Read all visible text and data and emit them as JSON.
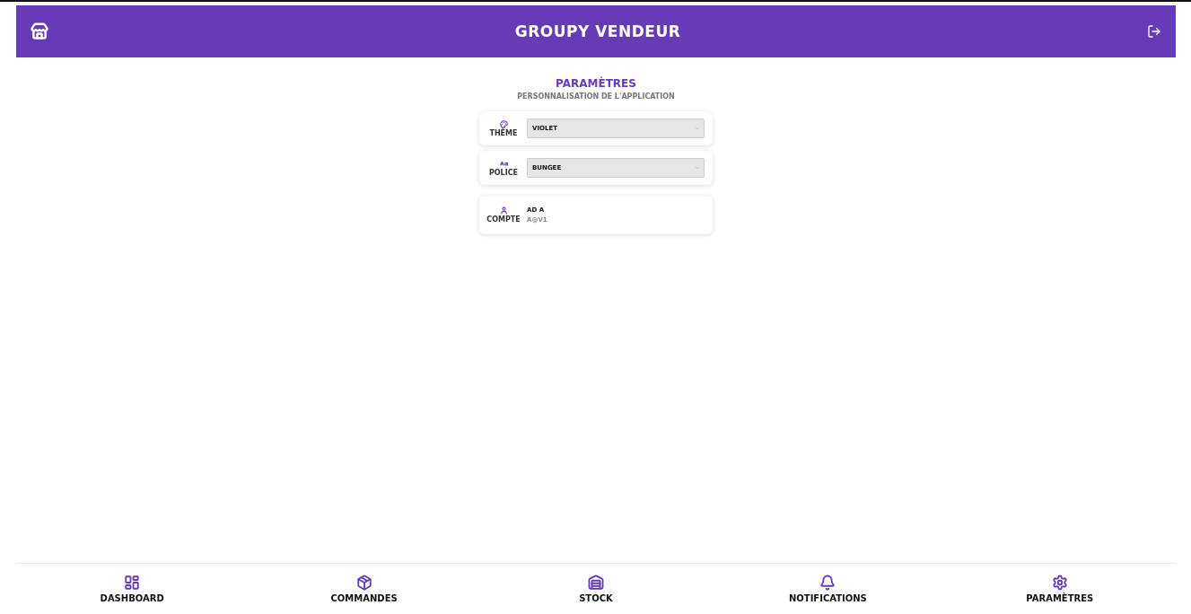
{
  "header": {
    "title": "GROUPY VENDEUR"
  },
  "page": {
    "title": "PARAMÈTRES",
    "subtitle": "PERSONNALISATION DE L'APPLICATION"
  },
  "settings": [
    {
      "kind": "select",
      "label": "THÈME",
      "value": "VIOLET"
    },
    {
      "kind": "select",
      "label": "POLICE",
      "value": "BUNGEE"
    },
    {
      "kind": "account",
      "label": "COMPTE",
      "name": "AD A",
      "email": "A@V1"
    }
  ],
  "nav": [
    {
      "label": "DASHBOARD"
    },
    {
      "label": "COMMANDES"
    },
    {
      "label": "STOCK"
    },
    {
      "label": "NOTIFICATIONS"
    },
    {
      "label": "PARAMÈTRES"
    }
  ]
}
